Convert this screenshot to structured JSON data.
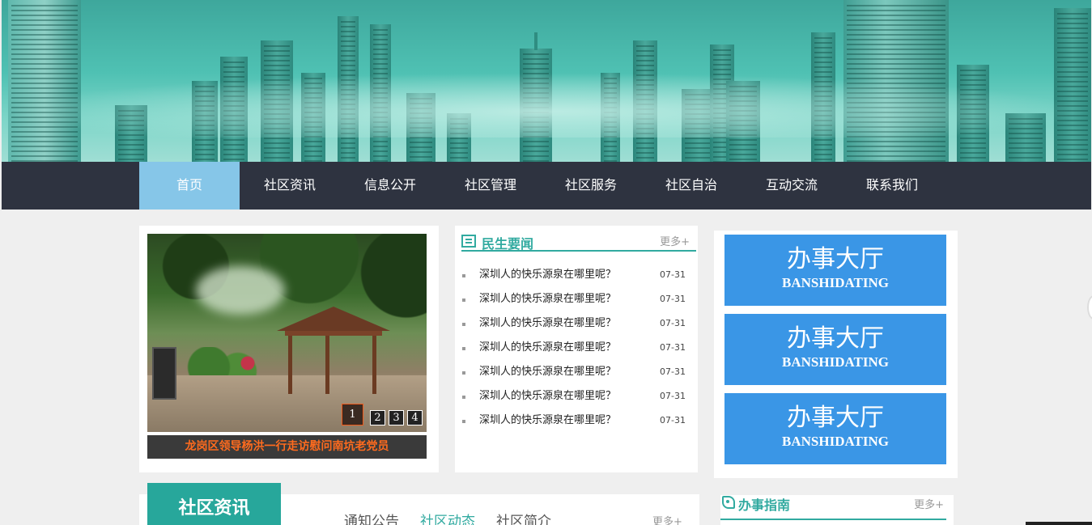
{
  "nav": {
    "items": [
      {
        "label": "首页",
        "active": true
      },
      {
        "label": "社区资讯"
      },
      {
        "label": "信息公开"
      },
      {
        "label": "社区管理"
      },
      {
        "label": "社区服务"
      },
      {
        "label": "社区自治"
      },
      {
        "label": "互动交流"
      },
      {
        "label": "联系我们"
      }
    ]
  },
  "slider": {
    "caption": "龙岗区领导杨洪一行走访慰问南坑老党员",
    "pages": [
      "1",
      "2",
      "3",
      "4"
    ],
    "active_page": 1
  },
  "news": {
    "title": "民生要闻",
    "more": "更多+",
    "items": [
      {
        "title": "深圳人的快乐源泉在哪里呢？",
        "date": "07-31"
      },
      {
        "title": "深圳人的快乐源泉在哪里呢？",
        "date": "07-31"
      },
      {
        "title": "深圳人的快乐源泉在哪里呢？",
        "date": "07-31"
      },
      {
        "title": "深圳人的快乐源泉在哪里呢？",
        "date": "07-31"
      },
      {
        "title": "深圳人的快乐源泉在哪里呢？",
        "date": "07-31"
      },
      {
        "title": "深圳人的快乐源泉在哪里呢？",
        "date": "07-31"
      },
      {
        "title": "深圳人的快乐源泉在哪里呢？",
        "date": "07-31"
      }
    ]
  },
  "hall": {
    "buttons": [
      {
        "cn": "办事大厅",
        "en": "BANSHIDATING"
      },
      {
        "cn": "办事大厅",
        "en": "BANSHIDATING"
      },
      {
        "cn": "办事大厅",
        "en": "BANSHIDATING"
      }
    ]
  },
  "community": {
    "title": "社区资讯",
    "tabs": [
      "通知公告",
      "社区动态",
      "社区简介"
    ],
    "active_tab": 1,
    "more": "更多+"
  },
  "guide": {
    "title": "办事指南",
    "more": "更多+"
  },
  "colors": {
    "teal": "#31aaa0",
    "nav_bg": "#2e3340",
    "nav_active": "#86c6e8",
    "hall_blue": "#3a96e6",
    "caption_orange": "#ff6b1e"
  }
}
